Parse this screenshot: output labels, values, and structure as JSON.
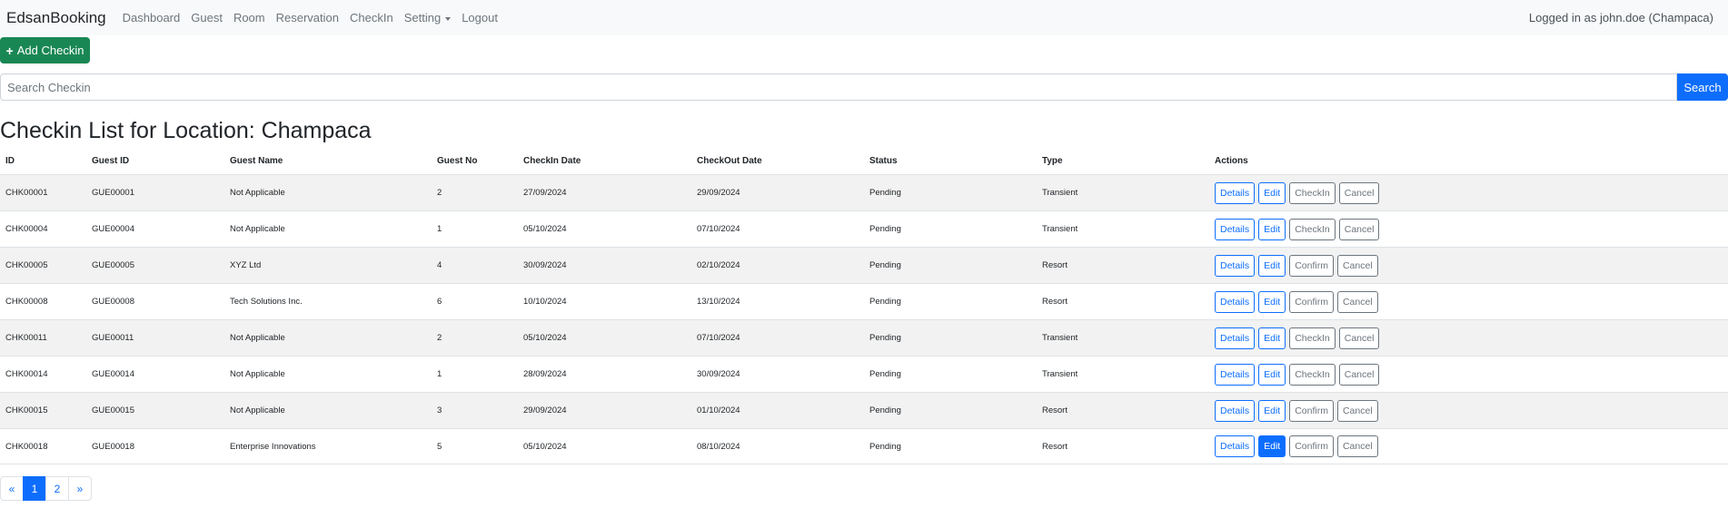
{
  "navbar": {
    "brand": "EdsanBooking",
    "links": [
      "Dashboard",
      "Guest",
      "Room",
      "Reservation",
      "CheckIn",
      "Setting",
      "Logout"
    ],
    "logged_in": "Logged in as john.doe (Champaca)"
  },
  "add_button": "Add Checkin",
  "search": {
    "placeholder": "Search Checkin",
    "button": "Search"
  },
  "title": "Checkin List for Location: Champaca",
  "table": {
    "headers": [
      "ID",
      "Guest ID",
      "Guest Name",
      "Guest No",
      "CheckIn Date",
      "CheckOut Date",
      "Status",
      "Type",
      "Actions"
    ],
    "rows": [
      {
        "id": "CHK00001",
        "guest_id": "GUE00001",
        "name": "Not Applicable",
        "no": "2",
        "in": "27/09/2024",
        "out": "29/09/2024",
        "status": "Pending",
        "type": "Transient",
        "b1": "Details",
        "b2": "Edit",
        "b3": "CheckIn",
        "b4": "Cancel"
      },
      {
        "id": "CHK00004",
        "guest_id": "GUE00004",
        "name": "Not Applicable",
        "no": "1",
        "in": "05/10/2024",
        "out": "07/10/2024",
        "status": "Pending",
        "type": "Transient",
        "b1": "Details",
        "b2": "Edit",
        "b3": "CheckIn",
        "b4": "Cancel"
      },
      {
        "id": "CHK00005",
        "guest_id": "GUE00005",
        "name": "XYZ Ltd",
        "no": "4",
        "in": "30/09/2024",
        "out": "02/10/2024",
        "status": "Pending",
        "type": "Resort",
        "b1": "Details",
        "b2": "Edit",
        "b3": "Confirm",
        "b4": "Cancel"
      },
      {
        "id": "CHK00008",
        "guest_id": "GUE00008",
        "name": "Tech Solutions Inc.",
        "no": "6",
        "in": "10/10/2024",
        "out": "13/10/2024",
        "status": "Pending",
        "type": "Resort",
        "b1": "Details",
        "b2": "Edit",
        "b3": "Confirm",
        "b4": "Cancel"
      },
      {
        "id": "CHK00011",
        "guest_id": "GUE00011",
        "name": "Not Applicable",
        "no": "2",
        "in": "05/10/2024",
        "out": "07/10/2024",
        "status": "Pending",
        "type": "Transient",
        "b1": "Details",
        "b2": "Edit",
        "b3": "CheckIn",
        "b4": "Cancel"
      },
      {
        "id": "CHK00014",
        "guest_id": "GUE00014",
        "name": "Not Applicable",
        "no": "1",
        "in": "28/09/2024",
        "out": "30/09/2024",
        "status": "Pending",
        "type": "Transient",
        "b1": "Details",
        "b2": "Edit",
        "b3": "CheckIn",
        "b4": "Cancel"
      },
      {
        "id": "CHK00015",
        "guest_id": "GUE00015",
        "name": "Not Applicable",
        "no": "3",
        "in": "29/09/2024",
        "out": "01/10/2024",
        "status": "Pending",
        "type": "Resort",
        "b1": "Details",
        "b2": "Edit",
        "b3": "Confirm",
        "b4": "Cancel"
      },
      {
        "id": "CHK00018",
        "guest_id": "GUE00018",
        "name": "Enterprise Innovations",
        "no": "5",
        "in": "05/10/2024",
        "out": "08/10/2024",
        "status": "Pending",
        "type": "Resort",
        "b1": "Details",
        "b2": "Edit",
        "b3": "Confirm",
        "b4": "Cancel"
      }
    ]
  },
  "pagination": {
    "prev": "«",
    "pages": [
      "1",
      "2"
    ],
    "next": "»",
    "current": "1"
  },
  "colors": {
    "primary": "#0d6efd",
    "success": "#198754",
    "secondary": "#6c757d",
    "navbar_bg": "#f8f9fa"
  }
}
